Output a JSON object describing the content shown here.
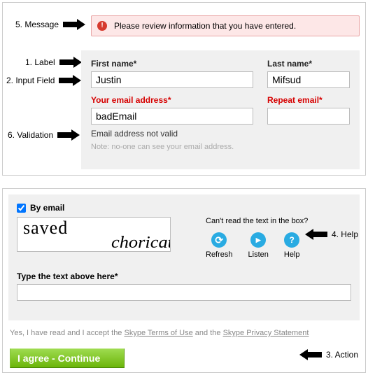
{
  "annotations": {
    "n1": "1. Label",
    "n2": "2. Input Field",
    "n3": "3. Action",
    "n4": "4. Help",
    "n5": "5. Message",
    "n6": "6. Validation"
  },
  "message": {
    "text": "Please review information that you have entered."
  },
  "fields": {
    "firstName": {
      "label": "First name*",
      "value": "Justin"
    },
    "lastName": {
      "label": "Last name*",
      "value": "Mifsud"
    },
    "email": {
      "label": "Your email address*",
      "value": "badEmail"
    },
    "repeatEmail": {
      "label": "Repeat email*",
      "value": ""
    }
  },
  "validation": {
    "email": "Email address not valid"
  },
  "note": "Note: no-one can see your email address.",
  "panel2": {
    "byEmail": "By email",
    "captchaWord1": "saved",
    "captchaWord2": "choricat",
    "cantRead": "Can't read the text in the box?",
    "refresh": "Refresh",
    "listen": "Listen",
    "help": "Help",
    "typeLabel": "Type the text above here*",
    "accept_pre": "Yes, I have read and I accept the ",
    "tos": "Skype Terms of Use",
    "and": " and the ",
    "privacy": "Skype Privacy Statement",
    "submit": "I agree - Continue"
  }
}
